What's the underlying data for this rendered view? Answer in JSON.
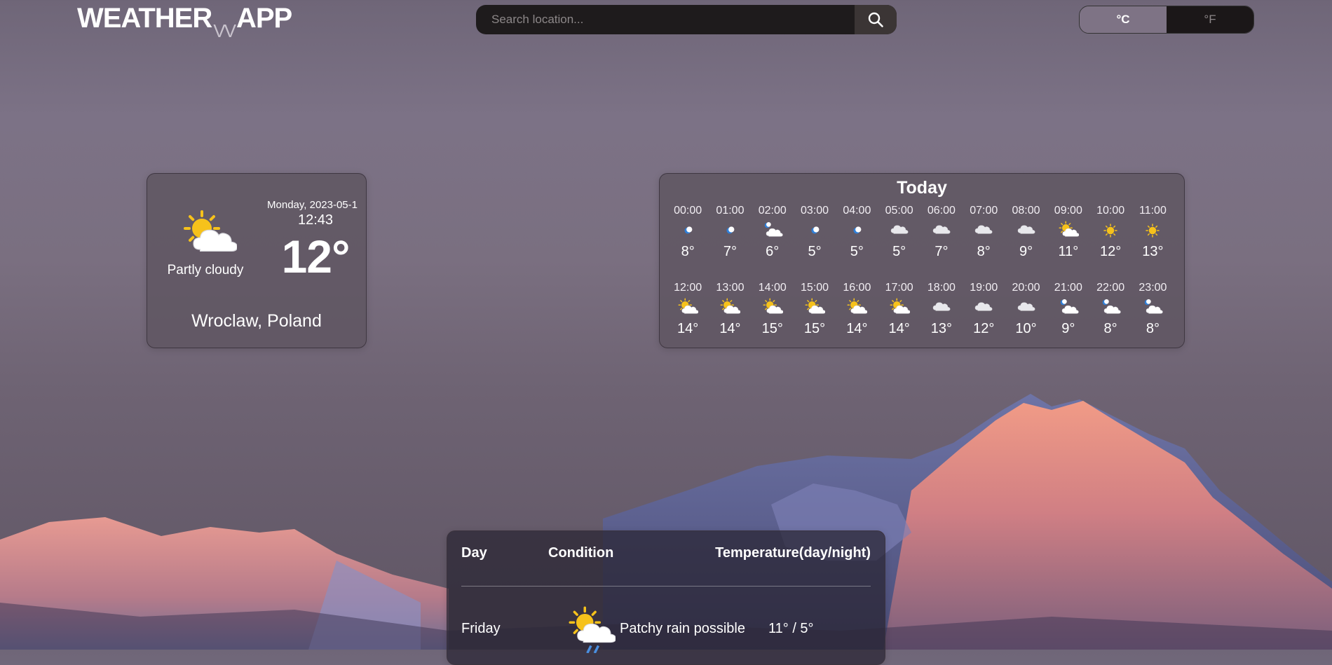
{
  "header": {
    "logo_left": "WEATHER",
    "logo_mid": "VV",
    "logo_right": "APP",
    "search_placeholder": "Search location...",
    "search_icon": "search-icon",
    "unit_celsius": "°C",
    "unit_fahrenheit": "°F",
    "selected_unit": "celsius"
  },
  "current": {
    "icon": "partly-cloudy-day-icon",
    "condition": "Partly cloudy",
    "date": "Monday, 2023-05-1",
    "time": "12:43",
    "temperature": "12°",
    "location": "Wroclaw, Poland"
  },
  "today": {
    "title": "Today",
    "hours": [
      {
        "time": "00:00",
        "icon": "clear-night-icon",
        "temp": "8°"
      },
      {
        "time": "01:00",
        "icon": "clear-night-icon",
        "temp": "7°"
      },
      {
        "time": "02:00",
        "icon": "partly-cloudy-night-icon",
        "temp": "6°"
      },
      {
        "time": "03:00",
        "icon": "clear-night-icon",
        "temp": "5°"
      },
      {
        "time": "04:00",
        "icon": "clear-night-icon",
        "temp": "5°"
      },
      {
        "time": "05:00",
        "icon": "cloudy-icon",
        "temp": "5°"
      },
      {
        "time": "06:00",
        "icon": "cloudy-icon",
        "temp": "7°"
      },
      {
        "time": "07:00",
        "icon": "cloudy-icon",
        "temp": "8°"
      },
      {
        "time": "08:00",
        "icon": "cloudy-icon",
        "temp": "9°"
      },
      {
        "time": "09:00",
        "icon": "partly-cloudy-day-icon",
        "temp": "11°"
      },
      {
        "time": "10:00",
        "icon": "sunny-icon",
        "temp": "12°"
      },
      {
        "time": "11:00",
        "icon": "sunny-icon",
        "temp": "13°"
      },
      {
        "time": "12:00",
        "icon": "partly-cloudy-day-icon",
        "temp": "14°"
      },
      {
        "time": "13:00",
        "icon": "partly-cloudy-day-icon",
        "temp": "14°"
      },
      {
        "time": "14:00",
        "icon": "partly-cloudy-day-icon",
        "temp": "15°"
      },
      {
        "time": "15:00",
        "icon": "partly-cloudy-day-icon",
        "temp": "15°"
      },
      {
        "time": "16:00",
        "icon": "partly-cloudy-day-icon",
        "temp": "14°"
      },
      {
        "time": "17:00",
        "icon": "partly-cloudy-day-icon",
        "temp": "14°"
      },
      {
        "time": "18:00",
        "icon": "cloudy-icon",
        "temp": "13°"
      },
      {
        "time": "19:00",
        "icon": "cloudy-icon",
        "temp": "12°"
      },
      {
        "time": "20:00",
        "icon": "cloudy-icon",
        "temp": "10°"
      },
      {
        "time": "21:00",
        "icon": "partly-cloudy-night-icon",
        "temp": "9°"
      },
      {
        "time": "22:00",
        "icon": "partly-cloudy-night-icon",
        "temp": "8°"
      },
      {
        "time": "23:00",
        "icon": "partly-cloudy-night-icon",
        "temp": "8°"
      }
    ]
  },
  "forecast": {
    "headers": {
      "day": "Day",
      "condition": "Condition",
      "temperature": "Temperature(day/night)"
    },
    "rows": [
      {
        "day": "Friday",
        "icon": "patchy-rain-icon",
        "condition": "Patchy rain possible",
        "temp": "11° / 5°"
      }
    ]
  },
  "colors": {
    "sun": "#f6c21b",
    "moon": "#2f7fd8",
    "cloud": "#ffffff",
    "cloud_dark": "#cfcfd4",
    "search_bg": "#1e1b1c",
    "unit_active": "#7e7385"
  }
}
